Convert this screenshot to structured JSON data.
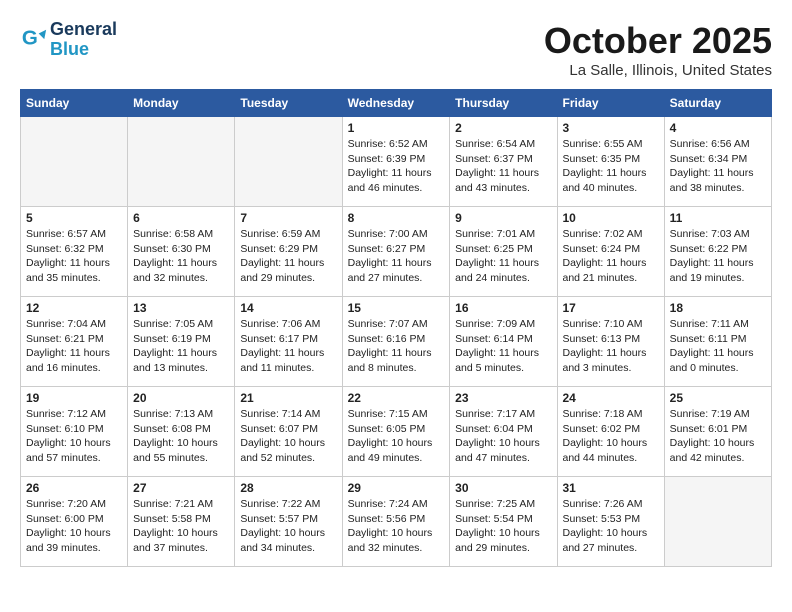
{
  "header": {
    "logo_line1": "General",
    "logo_line2": "Blue",
    "month": "October 2025",
    "location": "La Salle, Illinois, United States"
  },
  "weekdays": [
    "Sunday",
    "Monday",
    "Tuesday",
    "Wednesday",
    "Thursday",
    "Friday",
    "Saturday"
  ],
  "weeks": [
    [
      {
        "day": "",
        "empty": true
      },
      {
        "day": "",
        "empty": true
      },
      {
        "day": "",
        "empty": true
      },
      {
        "day": "1",
        "sun": "6:52 AM",
        "set": "6:39 PM",
        "dl": "11 hours and 46 minutes."
      },
      {
        "day": "2",
        "sun": "6:54 AM",
        "set": "6:37 PM",
        "dl": "11 hours and 43 minutes."
      },
      {
        "day": "3",
        "sun": "6:55 AM",
        "set": "6:35 PM",
        "dl": "11 hours and 40 minutes."
      },
      {
        "day": "4",
        "sun": "6:56 AM",
        "set": "6:34 PM",
        "dl": "11 hours and 38 minutes."
      }
    ],
    [
      {
        "day": "5",
        "sun": "6:57 AM",
        "set": "6:32 PM",
        "dl": "11 hours and 35 minutes."
      },
      {
        "day": "6",
        "sun": "6:58 AM",
        "set": "6:30 PM",
        "dl": "11 hours and 32 minutes."
      },
      {
        "day": "7",
        "sun": "6:59 AM",
        "set": "6:29 PM",
        "dl": "11 hours and 29 minutes."
      },
      {
        "day": "8",
        "sun": "7:00 AM",
        "set": "6:27 PM",
        "dl": "11 hours and 27 minutes."
      },
      {
        "day": "9",
        "sun": "7:01 AM",
        "set": "6:25 PM",
        "dl": "11 hours and 24 minutes."
      },
      {
        "day": "10",
        "sun": "7:02 AM",
        "set": "6:24 PM",
        "dl": "11 hours and 21 minutes."
      },
      {
        "day": "11",
        "sun": "7:03 AM",
        "set": "6:22 PM",
        "dl": "11 hours and 19 minutes."
      }
    ],
    [
      {
        "day": "12",
        "sun": "7:04 AM",
        "set": "6:21 PM",
        "dl": "11 hours and 16 minutes."
      },
      {
        "day": "13",
        "sun": "7:05 AM",
        "set": "6:19 PM",
        "dl": "11 hours and 13 minutes."
      },
      {
        "day": "14",
        "sun": "7:06 AM",
        "set": "6:17 PM",
        "dl": "11 hours and 11 minutes."
      },
      {
        "day": "15",
        "sun": "7:07 AM",
        "set": "6:16 PM",
        "dl": "11 hours and 8 minutes."
      },
      {
        "day": "16",
        "sun": "7:09 AM",
        "set": "6:14 PM",
        "dl": "11 hours and 5 minutes."
      },
      {
        "day": "17",
        "sun": "7:10 AM",
        "set": "6:13 PM",
        "dl": "11 hours and 3 minutes."
      },
      {
        "day": "18",
        "sun": "7:11 AM",
        "set": "6:11 PM",
        "dl": "11 hours and 0 minutes."
      }
    ],
    [
      {
        "day": "19",
        "sun": "7:12 AM",
        "set": "6:10 PM",
        "dl": "10 hours and 57 minutes."
      },
      {
        "day": "20",
        "sun": "7:13 AM",
        "set": "6:08 PM",
        "dl": "10 hours and 55 minutes."
      },
      {
        "day": "21",
        "sun": "7:14 AM",
        "set": "6:07 PM",
        "dl": "10 hours and 52 minutes."
      },
      {
        "day": "22",
        "sun": "7:15 AM",
        "set": "6:05 PM",
        "dl": "10 hours and 49 minutes."
      },
      {
        "day": "23",
        "sun": "7:17 AM",
        "set": "6:04 PM",
        "dl": "10 hours and 47 minutes."
      },
      {
        "day": "24",
        "sun": "7:18 AM",
        "set": "6:02 PM",
        "dl": "10 hours and 44 minutes."
      },
      {
        "day": "25",
        "sun": "7:19 AM",
        "set": "6:01 PM",
        "dl": "10 hours and 42 minutes."
      }
    ],
    [
      {
        "day": "26",
        "sun": "7:20 AM",
        "set": "6:00 PM",
        "dl": "10 hours and 39 minutes."
      },
      {
        "day": "27",
        "sun": "7:21 AM",
        "set": "5:58 PM",
        "dl": "10 hours and 37 minutes."
      },
      {
        "day": "28",
        "sun": "7:22 AM",
        "set": "5:57 PM",
        "dl": "10 hours and 34 minutes."
      },
      {
        "day": "29",
        "sun": "7:24 AM",
        "set": "5:56 PM",
        "dl": "10 hours and 32 minutes."
      },
      {
        "day": "30",
        "sun": "7:25 AM",
        "set": "5:54 PM",
        "dl": "10 hours and 29 minutes."
      },
      {
        "day": "31",
        "sun": "7:26 AM",
        "set": "5:53 PM",
        "dl": "10 hours and 27 minutes."
      },
      {
        "day": "",
        "empty": true
      }
    ]
  ]
}
